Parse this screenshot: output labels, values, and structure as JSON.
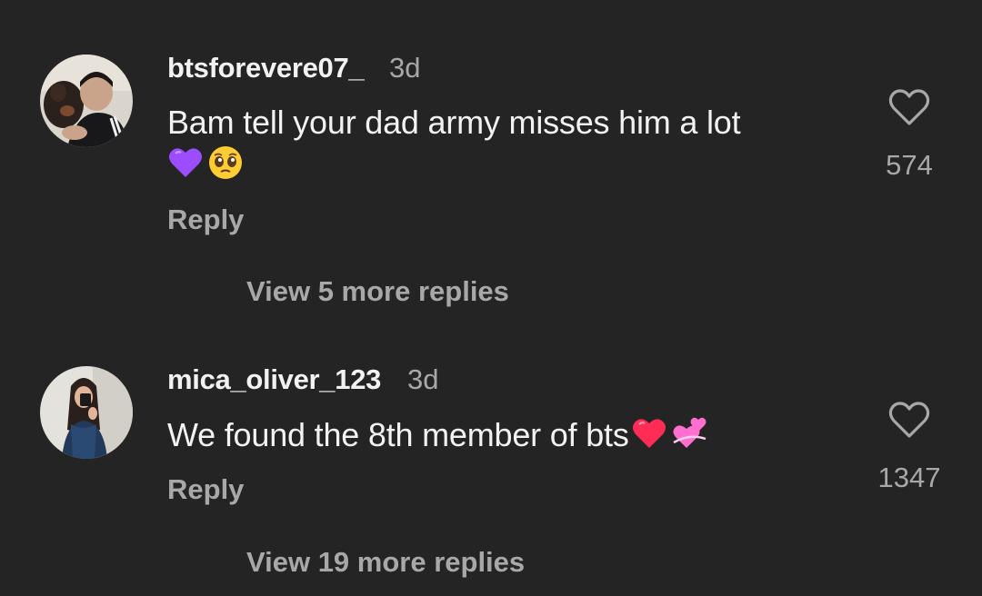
{
  "comments": [
    {
      "avatar_icon": "avatar-photo-man-with-dog",
      "username": "btsforevere07_",
      "timestamp": "3d",
      "text_line1": "Bam tell your dad army misses him a lot",
      "emojis": [
        "purple-heart-emoji",
        "pleading-face-emoji"
      ],
      "reply_label": "Reply",
      "like_count": "574",
      "like_icon": "heart-outline-icon",
      "view_replies_label": "View 5 more replies"
    },
    {
      "avatar_icon": "avatar-photo-woman-mirror-selfie",
      "username": "mica_oliver_123",
      "timestamp": "3d",
      "text_line1": "We found the 8th member of bts",
      "emojis": [
        "red-heart-emoji",
        "two-hearts-emoji"
      ],
      "reply_label": "Reply",
      "like_count": "1347",
      "like_icon": "heart-outline-icon",
      "view_replies_label": "View 19 more replies"
    }
  ],
  "colors": {
    "background": "#242424",
    "primary_text": "#f2f2f2",
    "secondary_text": "#a8a8a8",
    "purple_heart": "#9b4dff",
    "red_heart": "#ff2d55",
    "pink_hearts": "#ff6fd0"
  }
}
